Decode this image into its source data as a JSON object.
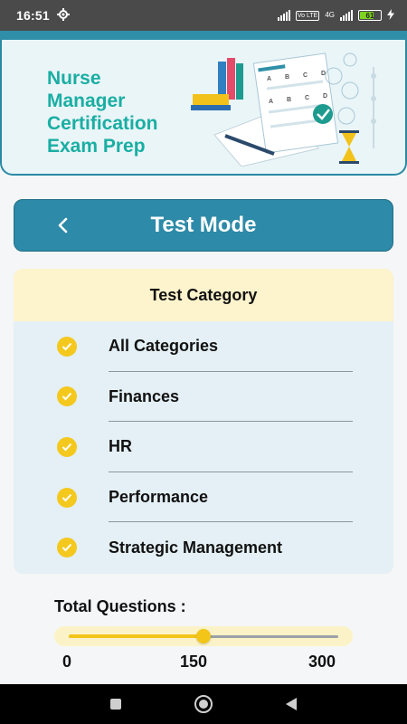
{
  "status_bar": {
    "time": "16:51",
    "battery": "61",
    "volte": "Vo LTE",
    "network": "4G"
  },
  "banner": {
    "title_lines": [
      "Nurse",
      "Manager",
      "Certification",
      "Exam Prep"
    ],
    "art_letters": [
      "A",
      "B",
      "C",
      "D"
    ]
  },
  "mode_bar": {
    "title": "Test Mode",
    "back_icon": "chevron-left-icon"
  },
  "category": {
    "heading": "Test Category",
    "items": [
      {
        "label": "All Categories",
        "checked": true
      },
      {
        "label": "Finances",
        "checked": true
      },
      {
        "label": "HR",
        "checked": true
      },
      {
        "label": "Performance",
        "checked": true
      },
      {
        "label": "Strategic Management",
        "checked": true
      }
    ]
  },
  "questions": {
    "label": "Total Questions :",
    "min": "0",
    "mid": "150",
    "max": "300",
    "value": 150,
    "range": [
      0,
      300
    ]
  },
  "colors": {
    "accent": "#2d8aa8",
    "check": "#f4c81d",
    "title": "#1aaea3"
  }
}
